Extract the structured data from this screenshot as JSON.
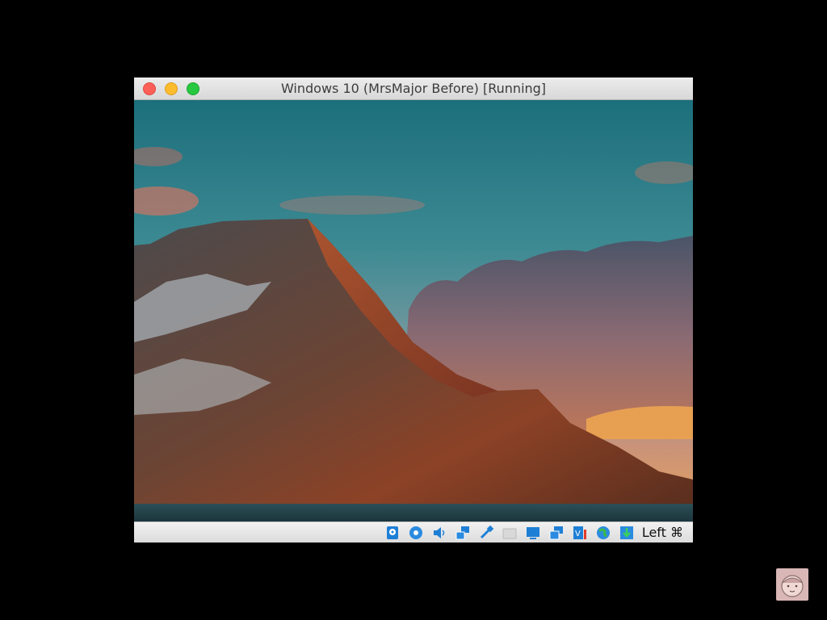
{
  "window": {
    "title": "Windows 10 (MrsMajor Before) [Running]"
  },
  "statusbar": {
    "host_key": "Left ⌘",
    "icons": [
      "hard-disk-icon",
      "optical-drive-icon",
      "audio-icon",
      "network-icon",
      "usb-icon",
      "shared-folders-icon",
      "display-icon",
      "video-capture-icon",
      "cpu-activity-icon",
      "guest-additions-icon",
      "mouse-integration-icon"
    ]
  },
  "colors": {
    "close": "#fc5f57",
    "minimize": "#fdbc2e",
    "zoom": "#28c840",
    "statusbar_icon": "#1e7fd6"
  }
}
